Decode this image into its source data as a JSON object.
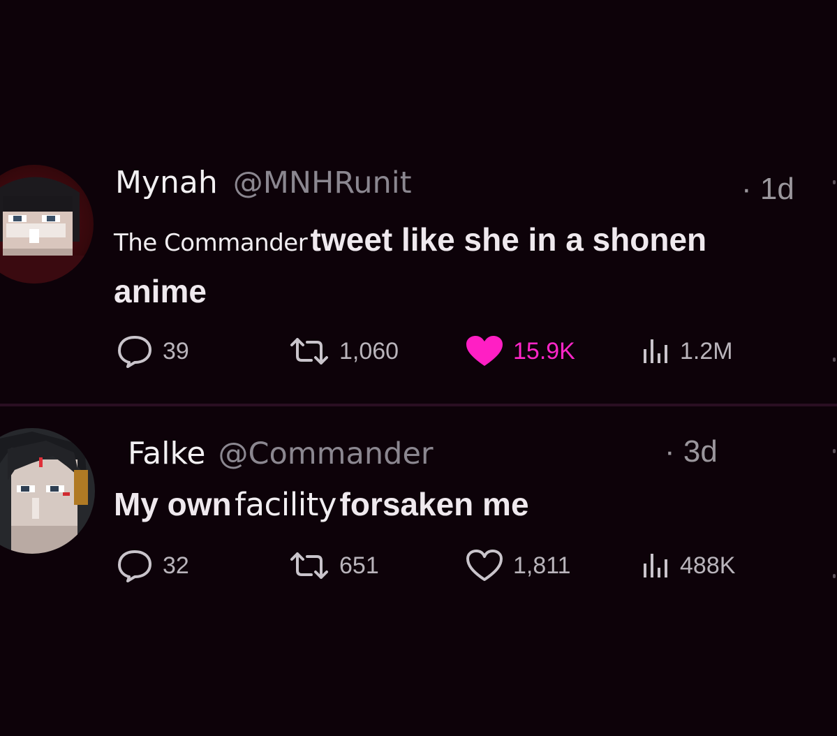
{
  "tweets": [
    {
      "author": {
        "display_name": "Mynah",
        "handle": "@MNHRunit"
      },
      "time": "· 1d",
      "text_line1_narrow": "The Commander",
      "text_line1_wide": "tweet like she in a shonen",
      "text_line2_wide": "anime",
      "stats": {
        "replies": "39",
        "retweets": "1,060",
        "likes": "15.9K",
        "views": "1.2M"
      },
      "liked": true,
      "avatar_icon": "user-avatar-icon"
    },
    {
      "author": {
        "display_name": "Falke",
        "handle": "@Commander"
      },
      "time": "· 3d",
      "text_line1_wide_a": "My own",
      "text_line1_narrow": "facility",
      "text_line1_wide_b": "forsaken me",
      "stats": {
        "replies": "32",
        "retweets": "651",
        "likes": "1,811",
        "views": "488K"
      },
      "liked": false,
      "avatar_icon": "user-avatar-icon"
    }
  ],
  "colors": {
    "background": "#0d0209",
    "like_active": "#ff26c8",
    "muted": "#8b8790"
  }
}
